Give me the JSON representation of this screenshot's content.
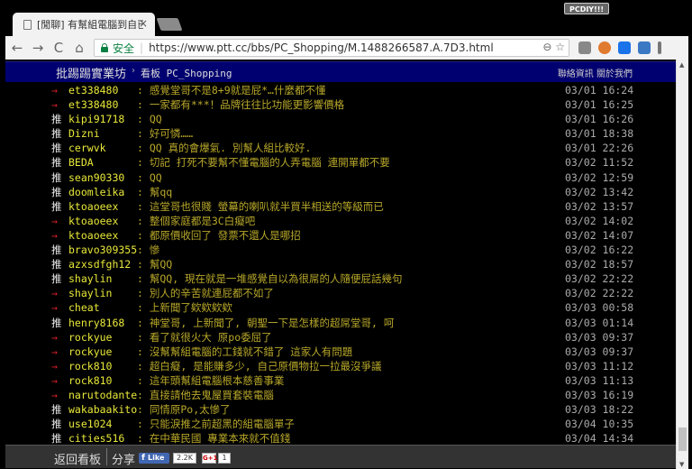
{
  "browser": {
    "tab_title": "[閒聊] 有幫組電腦到自已",
    "tab_close": "×",
    "ext_badge": "PCDIY!!!",
    "secure_label": "安全",
    "url": "https://www.ptt.cc/bbs/PC_Shopping/M.1488266587.A.7D3.html",
    "nav": {
      "back": "←",
      "forward": "→",
      "reload": "C",
      "home": "⌂"
    },
    "url_actions": "⊖ ☆"
  },
  "header": {
    "site_title": "批踢踢實業坊",
    "crumb_arrow": "›",
    "board_label": "看板 PC_Shopping",
    "right_links": "聯絡資訊  關於我們"
  },
  "comments": [
    {
      "tag": "→",
      "user": "et338480",
      "content": ": 感覺堂哥不是8+9就是屁*…什麼都不懂",
      "time": "03/01 16:24"
    },
    {
      "tag": "→",
      "user": "et338480",
      "content": ": 一家都有***！品牌往往比功能更影響價格",
      "time": "03/01 16:25"
    },
    {
      "tag": "推",
      "user": "kipi91718",
      "content": ": QQ",
      "time": "03/01 16:26"
    },
    {
      "tag": "推",
      "user": "Dizni",
      "content": ": 好可憐……",
      "time": "03/01 18:38"
    },
    {
      "tag": "推",
      "user": "cerwvk",
      "content": ": QQ  真的會爆氣. 別幫人組比較好.",
      "time": "03/01 22:26"
    },
    {
      "tag": "推",
      "user": "BEDA",
      "content": ": 切記 打死不要幫不懂電腦的人弄電腦 連開單都不要",
      "time": "03/02 11:52"
    },
    {
      "tag": "推",
      "user": "sean90330",
      "content": ": QQ",
      "time": "03/02 12:59"
    },
    {
      "tag": "推",
      "user": "doomleika",
      "content": ": 幫qq",
      "time": "03/02 13:42"
    },
    {
      "tag": "推",
      "user": "ktoaoeex",
      "content": ": 這堂哥也很賤 螢幕的喇叭就半買半相送的等級而已",
      "time": "03/02 13:57"
    },
    {
      "tag": "→",
      "user": "ktoaoeex",
      "content": ": 整個家庭都是3C白癡吧",
      "time": "03/02 14:02"
    },
    {
      "tag": "→",
      "user": "ktoaoeex",
      "content": ": 都原價收回了 發票不還人是哪招",
      "time": "03/02 14:07"
    },
    {
      "tag": "推",
      "user": "bravo309355",
      "content": ": 慘",
      "time": "03/02 16:22"
    },
    {
      "tag": "推",
      "user": "azxsdfgh12",
      "content": ": 幫QQ",
      "time": "03/02 18:57"
    },
    {
      "tag": "推",
      "user": "shaylin",
      "content": ": 幫QQ, 現在就是一堆感覺自以為很屌的人隨便屁話幾句",
      "time": "03/02 22:22"
    },
    {
      "tag": "→",
      "user": "shaylin",
      "content": ": 別人的辛苦就連屁都不如了",
      "time": "03/02 22:22"
    },
    {
      "tag": "→",
      "user": "cheat",
      "content": ": 上新聞了欸欸欸欸",
      "time": "03/03 00:58"
    },
    {
      "tag": "推",
      "user": "henry8168",
      "content": ": 神堂哥, 上新聞了, 朝聖一下是怎樣的超屌堂哥, 呵",
      "time": "03/03 01:14"
    },
    {
      "tag": "→",
      "user": "rockyue",
      "content": ": 看了就很火大  原po委屈了",
      "time": "03/03 09:37"
    },
    {
      "tag": "→",
      "user": "rockyue",
      "content": ": 沒幫幫組電腦的工錢就不錯了  這家人有問題",
      "time": "03/03 09:37"
    },
    {
      "tag": "→",
      "user": "rock810",
      "content": ": 超白癡, 是能賺多少, 自己原價物拉一拉最沒爭議",
      "time": "03/03 11:12"
    },
    {
      "tag": "→",
      "user": "rock810",
      "content": ": 這年頭幫組電腦根本慈善事業",
      "time": "03/03 11:13"
    },
    {
      "tag": "→",
      "user": "narutodante",
      "content": ": 直接請他去鬼屋買套裝電腦",
      "time": "03/03 16:19"
    },
    {
      "tag": "推",
      "user": "wakabaakito",
      "content": ": 同情原Po,太慘了",
      "time": "03/03 18:22"
    },
    {
      "tag": "推",
      "user": "use1024",
      "content": ": 只能淚推之前超黑的組電腦單子",
      "time": "03/04 10:35"
    },
    {
      "tag": "推",
      "user": "cities516",
      "content": ": 在中華民國 專業本來就不值錢",
      "time": "03/04 14:34"
    }
  ],
  "footer": {
    "back_label": "返回看板",
    "share_label": "分享",
    "fb_like": "Like",
    "fb_count": "2.2K",
    "gplus_label": "G+1",
    "gplus_count": "1"
  },
  "colors": {
    "push": "#eeeeee",
    "arrow": "#e0202a",
    "user": "#e8e83a",
    "content": "#b8a82a",
    "time": "#ababab",
    "topbar": "#000070"
  }
}
